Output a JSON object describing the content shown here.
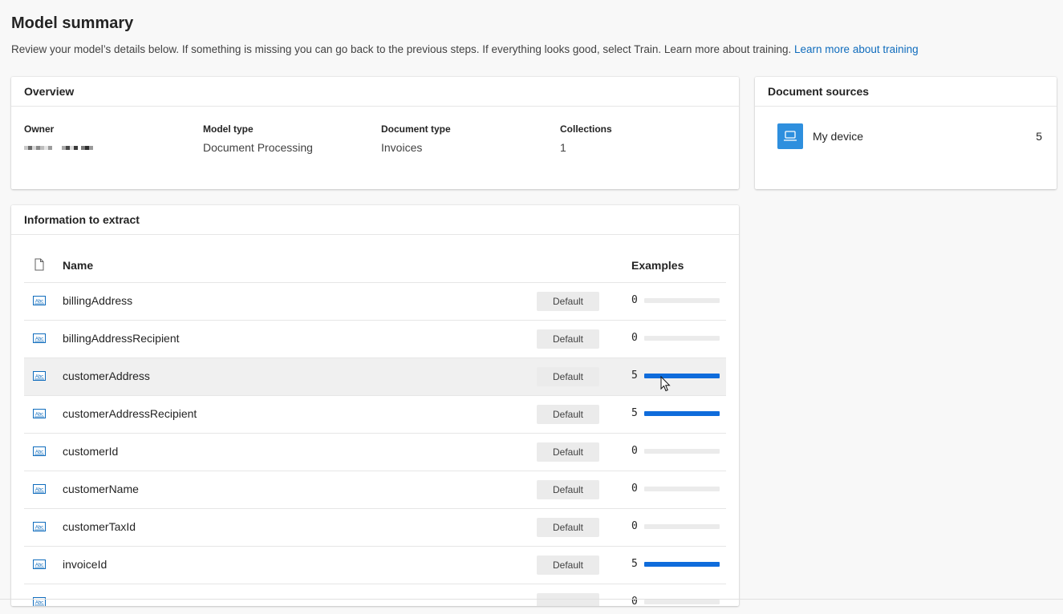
{
  "page": {
    "title": "Model summary",
    "description": "Review your model’s details below. If something is missing you can go back to the previous steps. If everything looks good, select Train. Learn more about training.",
    "learn_more_link": "Learn more about training"
  },
  "overview": {
    "header": "Overview",
    "owner_label": "Owner",
    "owner_value": "",
    "model_type_label": "Model type",
    "model_type_value": "Document Processing",
    "document_type_label": "Document type",
    "document_type_value": "Invoices",
    "collections_label": "Collections",
    "collections_value": "1"
  },
  "sources": {
    "header": "Document sources",
    "items": [
      {
        "name": "My device",
        "count": "5",
        "icon": "laptop-icon"
      }
    ]
  },
  "extract": {
    "header": "Information to extract",
    "columns": {
      "name": "Name",
      "examples": "Examples"
    },
    "rows": [
      {
        "name": "billingAddress",
        "badge": "Default",
        "count": "0",
        "progress": 0
      },
      {
        "name": "billingAddressRecipient",
        "badge": "Default",
        "count": "0",
        "progress": 0
      },
      {
        "name": "customerAddress",
        "badge": "Default",
        "count": "5",
        "progress": 1
      },
      {
        "name": "customerAddressRecipient",
        "badge": "Default",
        "count": "5",
        "progress": 1
      },
      {
        "name": "customerId",
        "badge": "Default",
        "count": "0",
        "progress": 0
      },
      {
        "name": "customerName",
        "badge": "Default",
        "count": "0",
        "progress": 0
      },
      {
        "name": "customerTaxId",
        "badge": "Default",
        "count": "0",
        "progress": 0
      },
      {
        "name": "invoiceId",
        "badge": "Default",
        "count": "5",
        "progress": 1
      },
      {
        "name": "",
        "badge": "",
        "count": "0",
        "progress": 0
      }
    ]
  },
  "colors": {
    "accent": "#0f6cdb",
    "link": "#0f6cbd",
    "device_tile": "#2e8fde"
  }
}
